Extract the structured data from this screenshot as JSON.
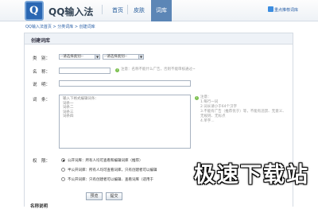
{
  "header": {
    "logo_letter": "Q",
    "brand": "QQ输入法",
    "nav": [
      "首页",
      "皮肤",
      "词库"
    ],
    "active_nav": "词库",
    "top_link": "重点推荐词库"
  },
  "breadcrumb": "QQ输入法首页 > 分类词库 > 创建词库",
  "panel_title": "创建词库",
  "form": {
    "category_label": "类　别：",
    "category_select_1": "--请选择类别--",
    "category_select_2": "--请选择类别--",
    "name_label": "名　称：",
    "name_hint": "注意：名称不能什么广告，否则不能审核通过~",
    "desc_label": "说　明：",
    "entries_label": "词　条：",
    "entries_placeholder": [
      "输入下格式编辑词条：",
      "词条一",
      "词条二",
      "词条三",
      "词条四"
    ],
    "entries_hints": [
      "注意：",
      "1.每行一词",
      "2.词长请小于64个汉字",
      "3.不能有广告（推荐优于）等，不能有违禁、无意义、无规则、无标点",
      "4.单字..."
    ],
    "permission_label": "权　限：",
    "permissions": [
      {
        "text": "公开词库：所有人均可查看和编辑词库（推荐）",
        "checked": true
      },
      {
        "text": "半公开词库：所有人均可查看词库，只有创建者可以编辑",
        "checked": false
      },
      {
        "text": "不公开词库：只有创建者可以编辑、查看词库（适用于",
        "checked": false
      }
    ],
    "preview_button": "预览",
    "submit_button": "提交"
  },
  "footer_label": "名称说明",
  "watermark": "极速下载站"
}
